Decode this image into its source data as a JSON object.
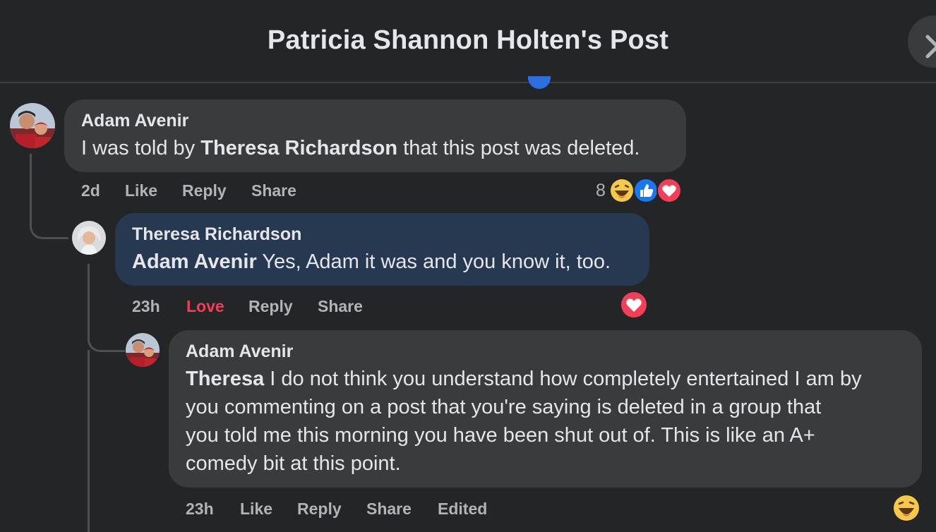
{
  "header": {
    "title": "Patricia Shannon Holten's Post"
  },
  "comments": [
    {
      "author": "Adam Avenir",
      "mention": "",
      "text_before": "I was told by ",
      "text_mention": "Theresa Richardson",
      "text_after": " that this post was deleted.",
      "time": "2d",
      "like_label": "Like",
      "reply_label": "Reply",
      "share_label": "Share",
      "reaction_count": "8",
      "reactions": [
        "haha-icon",
        "like-icon",
        "love-icon"
      ]
    },
    {
      "author": "Theresa Richardson",
      "mention": "Adam Avenir",
      "text": " Yes, Adam it was and you know it, too.",
      "time": "23h",
      "like_label": "Love",
      "reply_label": "Reply",
      "share_label": "Share",
      "reactions": [
        "love-icon"
      ]
    },
    {
      "author": "Adam Avenir",
      "mention": "Theresa",
      "text_line1": " I do not think you understand how completely entertained I am by",
      "text_line2": "you commenting on a post that you're saying is deleted in a group that",
      "text_line3": "you told me this morning you have been shut out of. This is like an A+",
      "text_line4": "comedy bit at this point.",
      "time": "23h",
      "like_label": "Like",
      "reply_label": "Reply",
      "share_label": "Share",
      "edited_label": "Edited",
      "reactions": [
        "haha-icon"
      ]
    }
  ],
  "colors": {
    "background": "#242526",
    "bubble": "#3a3b3c",
    "bubble_highlight": "#263951",
    "love": "#f33e58",
    "like": "#1877f2"
  }
}
